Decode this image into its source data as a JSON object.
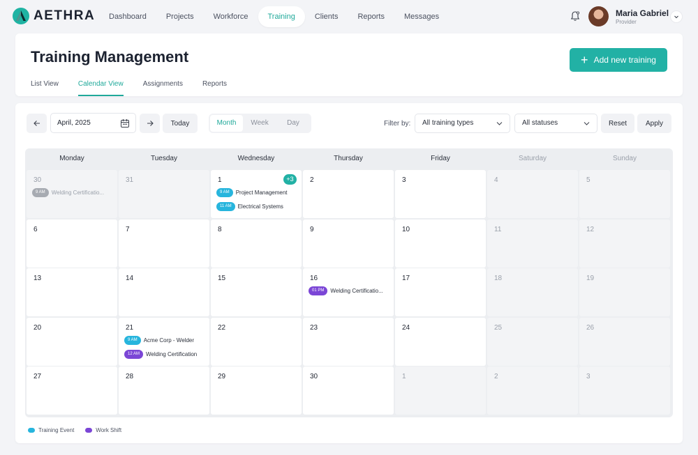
{
  "app": {
    "brand": "AETHRA"
  },
  "nav": [
    {
      "label": "Dashboard",
      "active": false
    },
    {
      "label": "Projects",
      "active": false
    },
    {
      "label": "Workforce",
      "active": false
    },
    {
      "label": "Training",
      "active": true
    },
    {
      "label": "Clients",
      "active": false
    },
    {
      "label": "Reports",
      "active": false
    },
    {
      "label": "Messages",
      "active": false
    }
  ],
  "user": {
    "name": "Maria Gabriel",
    "role": "Provider"
  },
  "icons": {
    "bell": "bell-icon",
    "chevron": "chevron-down-icon",
    "calendar": "calendar-icon",
    "prev": "arrow-left-icon",
    "next": "arrow-right-icon",
    "plus": "plus-icon"
  },
  "header": {
    "title": "Training Management",
    "add_button": "Add new training"
  },
  "tabs": [
    {
      "label": "List View",
      "active": false
    },
    {
      "label": "Calendar View",
      "active": true
    },
    {
      "label": "Assignments",
      "active": false
    },
    {
      "label": "Reports",
      "active": false
    }
  ],
  "toolbar": {
    "date_value": "April, 2025",
    "today_label": "Today",
    "views": [
      {
        "label": "Month",
        "active": true
      },
      {
        "label": "Week",
        "active": false
      },
      {
        "label": "Day",
        "active": false
      }
    ],
    "filter_label": "Filter by:",
    "type_select": "All training types",
    "status_select": "All statuses",
    "reset_label": "Reset",
    "apply_label": "Apply"
  },
  "colors": {
    "accent": "#22b1a5",
    "training": "#27b5dd",
    "shift": "#7b46d6",
    "past": "#a7abb2"
  },
  "calendar": {
    "weekdays": [
      "Monday",
      "Tuesday",
      "Wednesday",
      "Thursday",
      "Friday",
      "Saturday",
      "Sunday"
    ],
    "weeks": [
      [
        {
          "day": "30",
          "muted": true,
          "events": [
            {
              "time": "9 AM",
              "title": "Welding Certificatio...",
              "kind": "past"
            }
          ]
        },
        {
          "day": "31",
          "muted": true,
          "events": []
        },
        {
          "day": "1",
          "more": "+3",
          "events": [
            {
              "time": "9 AM",
              "title": "Project Management",
              "kind": "training"
            },
            {
              "time": "11 AM",
              "title": "Electrical Systems",
              "kind": "training"
            }
          ]
        },
        {
          "day": "2",
          "events": []
        },
        {
          "day": "3",
          "events": []
        },
        {
          "day": "4",
          "weekend": true,
          "events": []
        },
        {
          "day": "5",
          "weekend": true,
          "events": []
        }
      ],
      [
        {
          "day": "6",
          "events": []
        },
        {
          "day": "7",
          "events": []
        },
        {
          "day": "8",
          "events": []
        },
        {
          "day": "9",
          "events": []
        },
        {
          "day": "10",
          "events": []
        },
        {
          "day": "11",
          "weekend": true,
          "events": []
        },
        {
          "day": "12",
          "weekend": true,
          "events": []
        }
      ],
      [
        {
          "day": "13",
          "events": []
        },
        {
          "day": "14",
          "events": []
        },
        {
          "day": "15",
          "events": []
        },
        {
          "day": "16",
          "events": [
            {
              "time": "01 PM",
              "title": "Welding Certificatio...",
              "kind": "shift"
            }
          ]
        },
        {
          "day": "17",
          "events": []
        },
        {
          "day": "18",
          "weekend": true,
          "events": []
        },
        {
          "day": "19",
          "weekend": true,
          "events": []
        }
      ],
      [
        {
          "day": "20",
          "events": []
        },
        {
          "day": "21",
          "events": [
            {
              "time": "9 AM",
              "title": "Acme Corp - Welder",
              "kind": "training"
            },
            {
              "time": "12 AM",
              "title": "Welding Certification",
              "kind": "shift"
            }
          ]
        },
        {
          "day": "22",
          "events": []
        },
        {
          "day": "23",
          "events": []
        },
        {
          "day": "24",
          "events": []
        },
        {
          "day": "25",
          "weekend": true,
          "events": []
        },
        {
          "day": "26",
          "weekend": true,
          "events": []
        }
      ],
      [
        {
          "day": "27",
          "events": []
        },
        {
          "day": "28",
          "events": []
        },
        {
          "day": "29",
          "events": []
        },
        {
          "day": "30",
          "events": []
        },
        {
          "day": "1",
          "muted": true,
          "events": []
        },
        {
          "day": "2",
          "muted": true,
          "events": []
        },
        {
          "day": "3",
          "muted": true,
          "events": []
        }
      ]
    ]
  },
  "legend": [
    {
      "label": "Training Event",
      "kind": "training"
    },
    {
      "label": "Work Shift",
      "kind": "shift"
    }
  ]
}
